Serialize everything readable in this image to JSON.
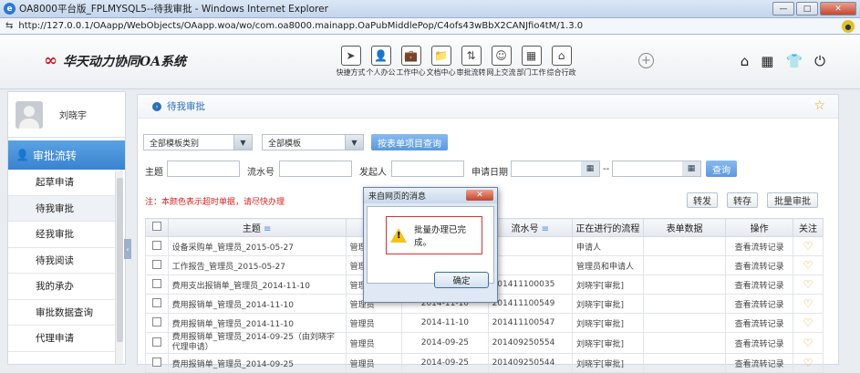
{
  "window": {
    "title": "OA8000平台版_FPLMYSQL5--待我审批 - Windows Internet Explorer",
    "min": "—",
    "max": "□",
    "close": "✕"
  },
  "address": {
    "url": "http://127.0.0.1/OAapp/WebObjects/OAapp.woa/wo/com.oa8000.mainapp.OaPubMiddlePop/C4ofs43wBbX2CANJfio4tM/1.3.0"
  },
  "header": {
    "logo_text": "华天动力协同OA系统",
    "nav": [
      {
        "label": "快捷方式",
        "icon": "➤"
      },
      {
        "label": "个人办公",
        "icon": "👤"
      },
      {
        "label": "工作中心",
        "icon": "💼"
      },
      {
        "label": "文档中心",
        "icon": "📁"
      },
      {
        "label": "审批流转",
        "icon": "⇅"
      },
      {
        "label": "网上交流",
        "icon": "☺"
      },
      {
        "label": "部门工作",
        "icon": "▦"
      },
      {
        "label": "综合行政",
        "icon": "⌂"
      }
    ],
    "plus": "+",
    "right_icons": [
      "⌂",
      "▦",
      "👕",
      "⏻"
    ]
  },
  "sidebar": {
    "user_name": "刘晓宇",
    "menu_title": "审批流转",
    "items": [
      "起草申请",
      "待我审批",
      "经我审批",
      "待我阅读",
      "我的承办",
      "审批数据查询",
      "代理申请"
    ]
  },
  "main": {
    "breadcrumb": "待我审批",
    "filters": {
      "category": "全部模板类别",
      "template": "全部模板",
      "query_by_item": "按表单项目查询",
      "subject_label": "主题",
      "serial_label": "流水号",
      "initiator_label": "发起人",
      "date_label": "申请日期",
      "date_sep": "--",
      "search": "查询"
    },
    "note": "注：本颜色表示超时单据，请尽快办理",
    "actions": {
      "forward": "转发",
      "save": "转存",
      "batch": "批量审批"
    },
    "table": {
      "headers": {
        "subject": "主题",
        "initiator": "发起",
        "date": "",
        "serial": "流水号",
        "flow": "正在进行的流程",
        "form": "表单数据",
        "op": "操作",
        "follow": "关注"
      },
      "rows": [
        {
          "subject": "设备采购单_管理员_2015-05-27",
          "initiator": "管理员",
          "date": "",
          "serial": "",
          "flow": "申请人",
          "op": "查看流转记录"
        },
        {
          "subject": "工作报告_管理员_2015-05-27",
          "initiator": "管理员",
          "date": "",
          "serial": "",
          "flow": "管理员和申请人",
          "op": "查看流转记录"
        },
        {
          "subject": "费用支出报销单_管理员_2014-11-10",
          "initiator": "管理员",
          "date": "2014-11-10",
          "serial": "201411100035",
          "flow": "刘晓宇[审批]",
          "op": "查看流转记录"
        },
        {
          "subject": "费用报销单_管理员_2014-11-10",
          "initiator": "管理员",
          "date": "2014-11-10",
          "serial": "201411100549",
          "flow": "刘晓宇[审批]",
          "op": "查看流转记录"
        },
        {
          "subject": "费用报销单_管理员_2014-11-10",
          "initiator": "管理员",
          "date": "2014-11-10",
          "serial": "201411100547",
          "flow": "刘晓宇[审批]",
          "op": "查看流转记录"
        },
        {
          "subject": "费用报销单_管理员_2014-09-25（由刘晓宇代理申请）",
          "initiator": "管理员",
          "date": "2014-09-25",
          "serial": "201409250554",
          "flow": "刘晓宇[审批]",
          "op": "查看流转记录"
        },
        {
          "subject": "费用报销单_管理员_2014-09-25",
          "initiator": "管理员",
          "date": "2014-09-25",
          "serial": "201409250544",
          "flow": "刘晓宇[审批]",
          "op": "查看流转记录"
        }
      ]
    }
  },
  "dialog": {
    "title": "来自网页的消息",
    "close": "✕",
    "message": "批量办理已完成。",
    "ok": "确定",
    "warn_glyph": "!"
  }
}
